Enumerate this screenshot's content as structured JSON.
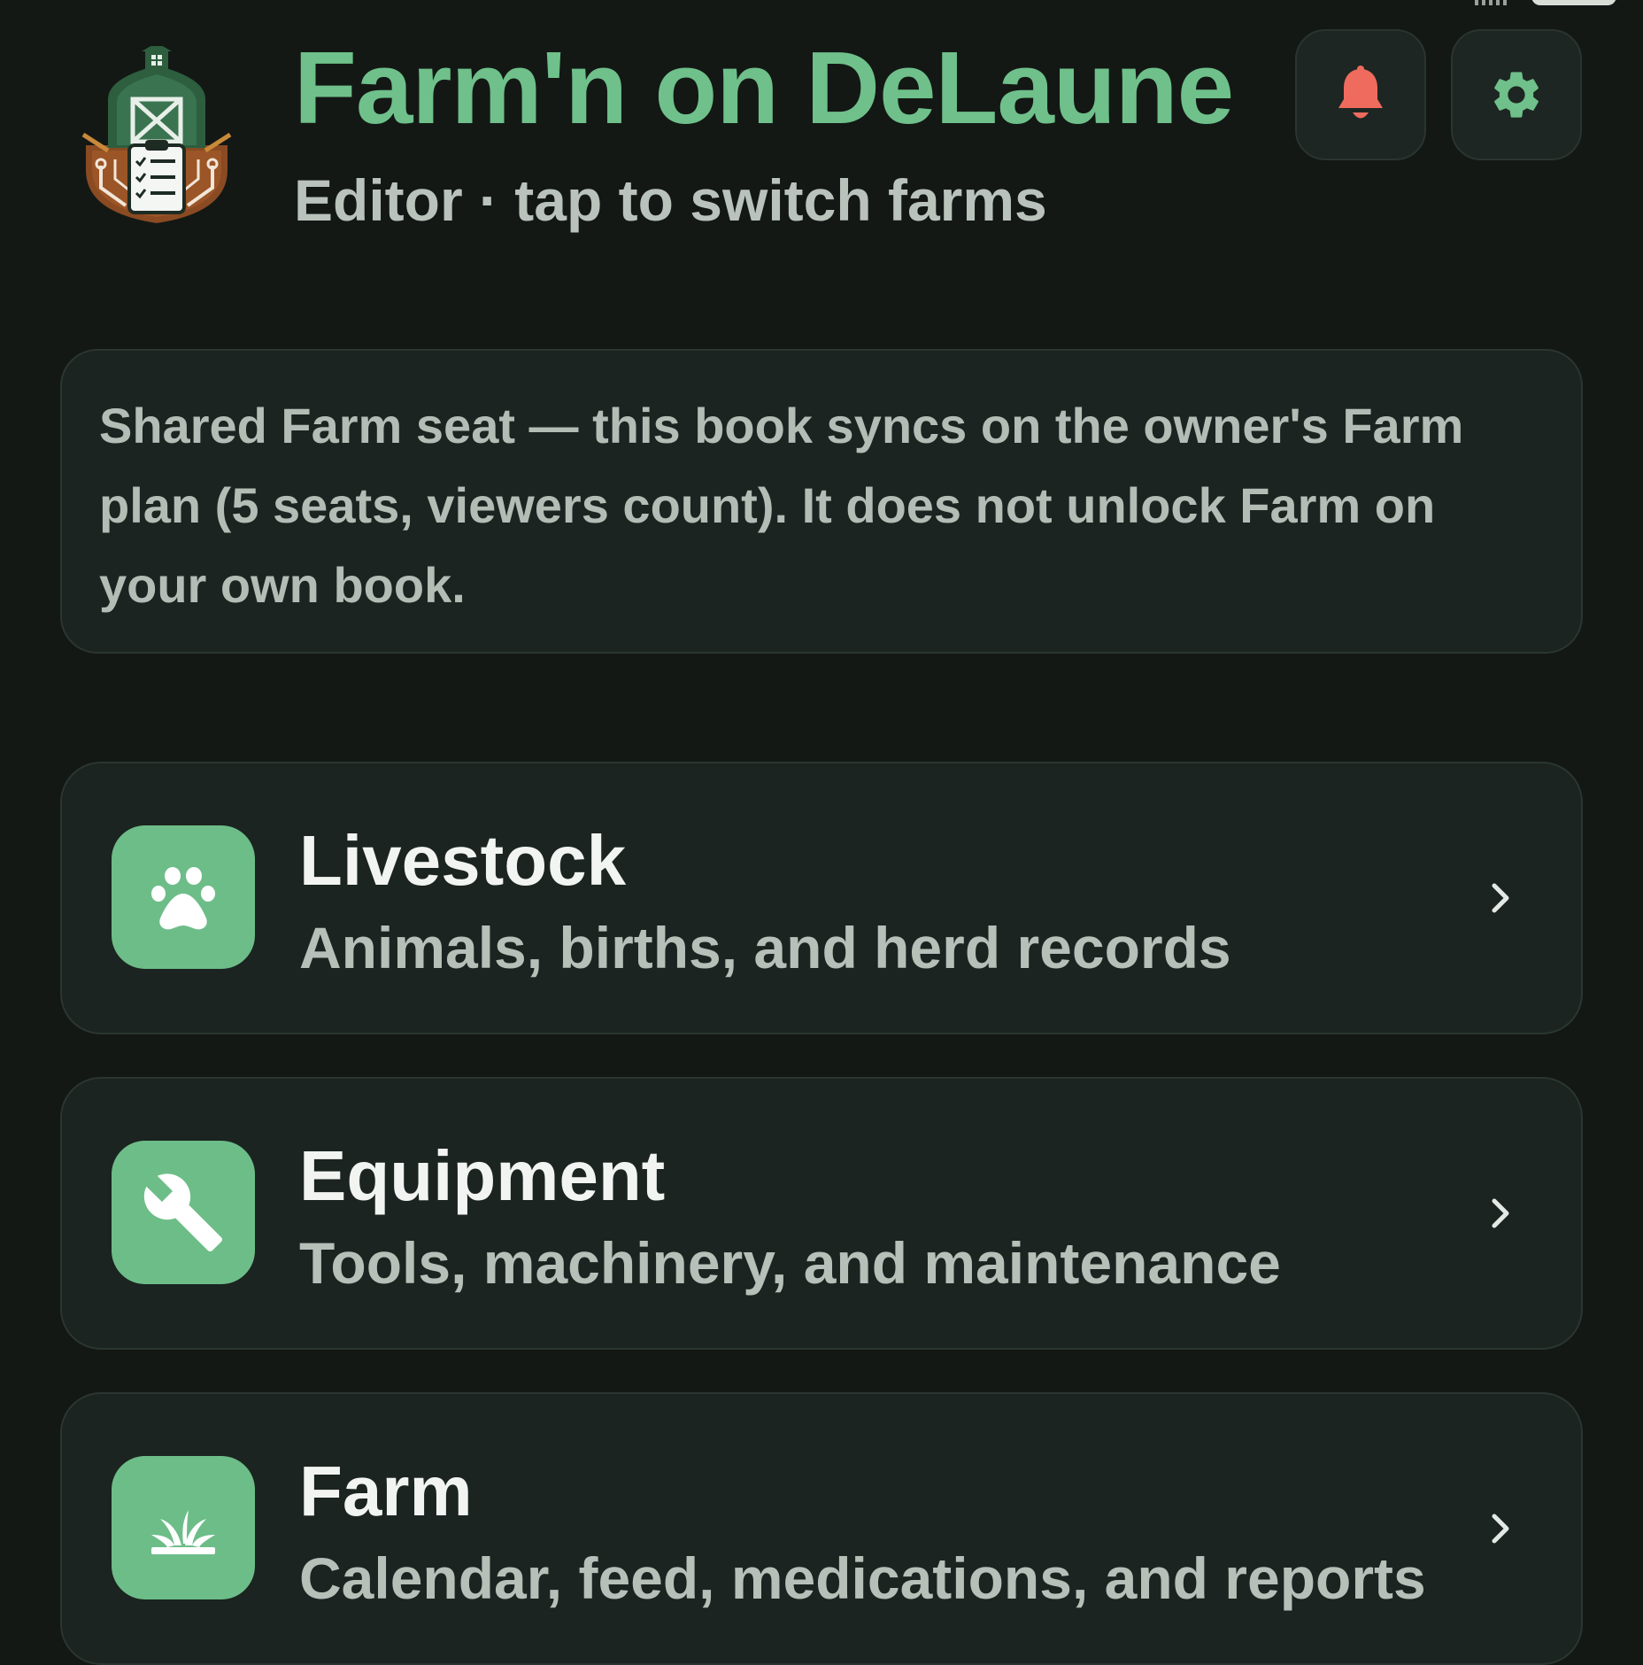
{
  "header": {
    "title": "Farm'n on DeLaune",
    "subtitle": "Editor · tap to switch farms",
    "logo_icon": "barn-clipboard-logo",
    "notifications_icon": "bell-icon",
    "settings_icon": "gear-icon"
  },
  "notice": {
    "text": "Shared Farm seat — this book syncs on the owner's Farm plan (5 seats, viewers count). It does not unlock Farm on your own book."
  },
  "nav": [
    {
      "title": "Livestock",
      "description": "Animals, births, and herd records",
      "icon": "paw-icon"
    },
    {
      "title": "Equipment",
      "description": "Tools, machinery, and maintenance",
      "icon": "wrench-icon"
    },
    {
      "title": "Farm",
      "description": "Calendar, feed, medications, and reports",
      "icon": "sprout-icon"
    }
  ],
  "colors": {
    "background": "#131815",
    "card": "#1b2420",
    "accent": "#6fc08a",
    "bell": "#ef6b5e"
  }
}
